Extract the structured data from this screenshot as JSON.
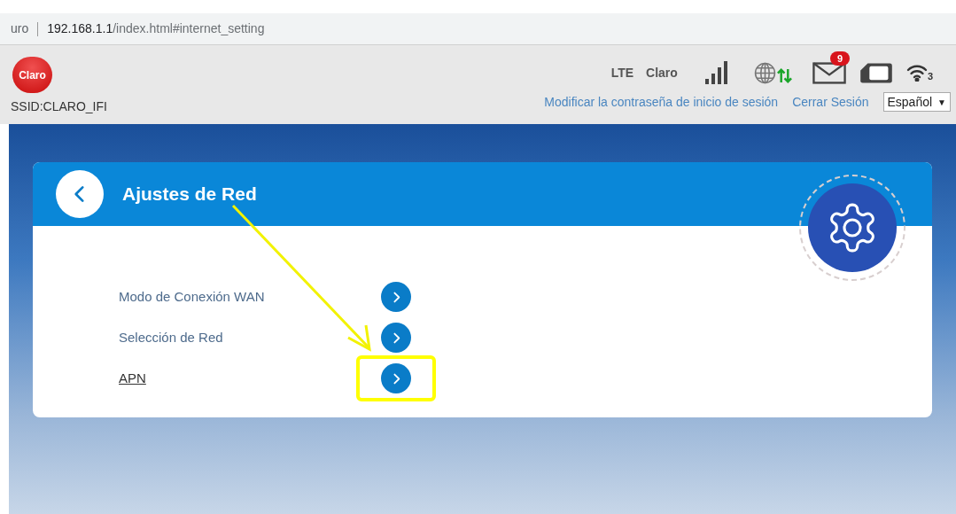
{
  "address_bar": {
    "tab_fragment": "uro",
    "host": "192.168.1.1",
    "path": "/index.html#internet_setting"
  },
  "header": {
    "logo_text": "Claro",
    "ssid": "SSID:CLARO_IFI",
    "network_type": "LTE",
    "operator": "Claro",
    "unread_messages": "9",
    "wifi_clients": "3",
    "links": [
      "Modificar la contraseña de inicio de sesión",
      "Cerrar Sesión"
    ],
    "language": {
      "value": "Español",
      "caret": "▼"
    }
  },
  "panel": {
    "title": "Ajustes de Red",
    "items": [
      {
        "label": "Modo de Conexión WAN",
        "hovered": false,
        "highlighted": false
      },
      {
        "label": "Selección de Red",
        "hovered": false,
        "highlighted": false
      },
      {
        "label": "APN",
        "hovered": true,
        "highlighted": true
      }
    ]
  }
}
